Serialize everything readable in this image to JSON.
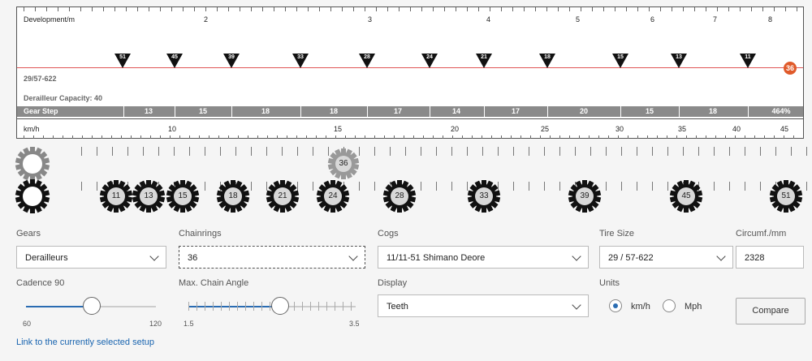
{
  "top_axis": {
    "label": "Development/m",
    "ticks": [
      "2",
      "3",
      "4",
      "5",
      "6",
      "7",
      "8"
    ]
  },
  "cog_markers": [
    "51",
    "45",
    "39",
    "33",
    "28",
    "24",
    "21",
    "18",
    "15",
    "13",
    "11"
  ],
  "chainring_marker": "36",
  "tire_label": "29/57-622",
  "derailleur_capacity": "Derailleur Capacity: 40",
  "gear_step": {
    "label": "Gear Step",
    "values": [
      "13",
      "15",
      "18",
      "18",
      "17",
      "14",
      "17",
      "20",
      "15",
      "18",
      "464%"
    ]
  },
  "speed_axis": {
    "label": "km/h",
    "ticks": [
      "10",
      "15",
      "20",
      "25",
      "30",
      "35",
      "40",
      "45"
    ]
  },
  "chainring_gear": "36",
  "cogs": [
    "11",
    "13",
    "15",
    "18",
    "21",
    "24",
    "28",
    "33",
    "39",
    "45",
    "51"
  ],
  "controls": {
    "gears_label": "Gears",
    "gears_value": "Derailleurs",
    "chainrings_label": "Chainrings",
    "chainrings_value": "36",
    "cogs_label": "Cogs",
    "cogs_value": "11/11-51 Shimano Deore",
    "tire_label": "Tire Size",
    "tire_value": "29 / 57-622",
    "circ_label": "Circumf./mm",
    "circ_value": "2328",
    "cadence_label": "Cadence 90",
    "cadence_min": "60",
    "cadence_max": "120",
    "cadence_value": 90,
    "chain_angle_label": "Max. Chain Angle",
    "chain_angle_min": "1.5",
    "chain_angle_max": "3.5",
    "chain_angle_value": 2.7,
    "display_label": "Display",
    "display_value": "Teeth",
    "units_label": "Units",
    "unit_kmh": "km/h",
    "unit_mph": "Mph",
    "compare_button": "Compare",
    "link_text": "Link to the currently selected setup"
  },
  "colors": {
    "accent": "#2a6cb2",
    "ring": "#e05a2a",
    "line": "#e05555"
  }
}
